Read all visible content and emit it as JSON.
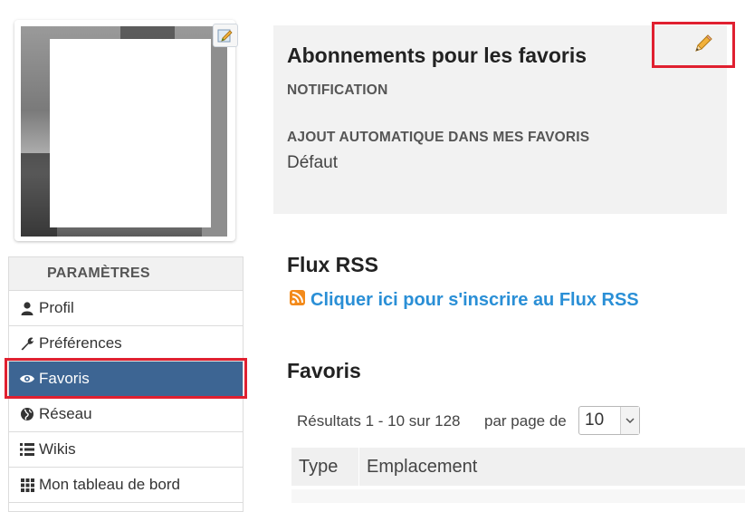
{
  "sidebar": {
    "header": "PARAMÈTRES",
    "items": [
      {
        "label": "Profil",
        "icon": "user-icon"
      },
      {
        "label": "Préférences",
        "icon": "wrench-icon"
      },
      {
        "label": "Favoris",
        "icon": "eye-icon",
        "active": true
      },
      {
        "label": "Réseau",
        "icon": "globe-icon"
      },
      {
        "label": "Wikis",
        "icon": "list-icon"
      },
      {
        "label": "Mon tableau de bord",
        "icon": "grid-icon"
      }
    ]
  },
  "subscriptions": {
    "title": "Abonnements pour les favoris",
    "notification_label": "NOTIFICATION",
    "auto_add_label": "AJOUT AUTOMATIQUE DANS MES FAVORIS",
    "auto_add_value": "Défaut"
  },
  "rss": {
    "title": "Flux RSS",
    "link_label": "Cliquer ici pour s'inscrire au Flux RSS"
  },
  "favorites": {
    "title": "Favoris",
    "results_text": "Résultats 1 - 10 sur 128",
    "per_page_label": "par page de",
    "per_page_value": "10",
    "columns": [
      "Type",
      "Emplacement"
    ]
  },
  "colors": {
    "active_bg": "#3d6593",
    "link": "#2a8fd6",
    "highlight_border": "#e02030"
  }
}
